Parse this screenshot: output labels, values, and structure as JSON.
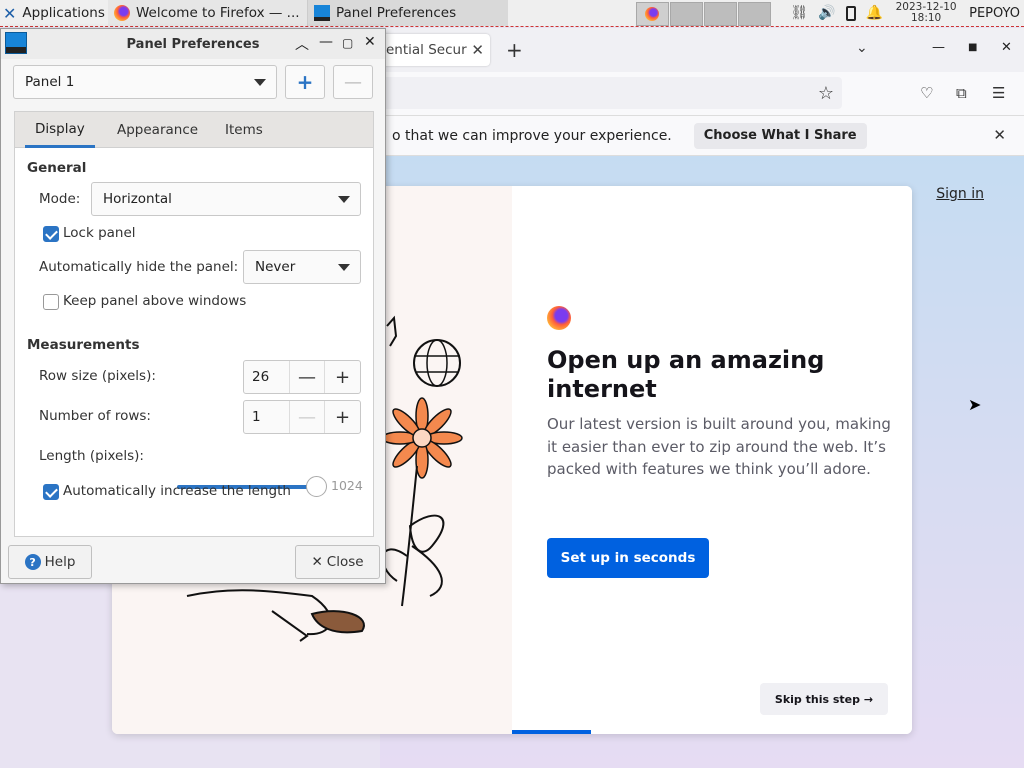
{
  "taskbar": {
    "applications_label": "Applications",
    "firefox_task": "Welcome to Firefox — ...",
    "panel_task": "Panel Preferences",
    "clock_date": "2023-12-10",
    "clock_time": "18:10",
    "user": "PEPOYO"
  },
  "firefox": {
    "tab_title": "ential Secur",
    "notice_text": "o that we can improve your experience.",
    "notice_button": "Choose What I Share",
    "sign_in": "Sign in",
    "headline": "Open up an amazing internet",
    "body": "Our latest version is built around you, making it easier than ever to zip around the web. It’s packed with features we think you’ll adore.",
    "setup_button": "Set up in seconds",
    "skip_button": "Skip this step →"
  },
  "dialog": {
    "title": "Panel Preferences",
    "panel_select": "Panel 1",
    "tabs": [
      "Display",
      "Appearance",
      "Items"
    ],
    "general_title": "General",
    "mode_label": "Mode:",
    "mode_value": "Horizontal",
    "lock_panel": "Lock panel",
    "lock_panel_checked": true,
    "autohide_label": "Automatically hide the panel:",
    "autohide_value": "Never",
    "keep_above": "Keep panel above windows",
    "keep_above_checked": false,
    "measurements_title": "Measurements",
    "row_size_label": "Row size (pixels):",
    "row_size_value": "26",
    "rows_label": "Number of rows:",
    "rows_value": "1",
    "length_label": "Length (pixels):",
    "length_value": "1024",
    "length_fraction": 1.0,
    "auto_increase": "Automatically increase the length",
    "auto_increase_checked": true,
    "help_button": "Help",
    "close_button": "Close"
  }
}
